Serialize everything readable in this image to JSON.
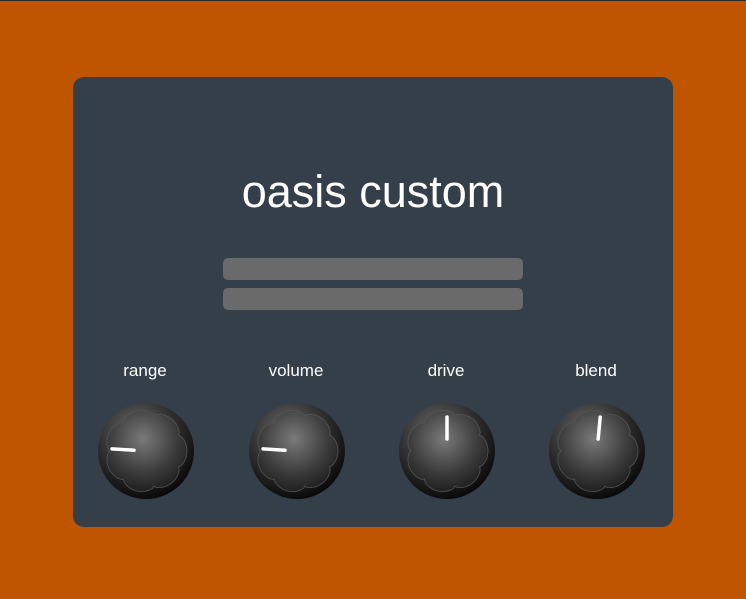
{
  "panel": {
    "title": "oasis custom",
    "background_color": "#343f4a",
    "outer_color": "#bf5500"
  },
  "display": {
    "bars": 2,
    "bar_color": "#6a6a6a"
  },
  "knobs": [
    {
      "label": "range",
      "icon": "knob-icon",
      "level": 0.18
    },
    {
      "label": "volume",
      "icon": "knob-icon",
      "level": 0.18
    },
    {
      "label": "drive",
      "icon": "knob-icon",
      "level": 0.5
    },
    {
      "label": "blend",
      "icon": "knob-icon",
      "level": 0.52
    }
  ]
}
